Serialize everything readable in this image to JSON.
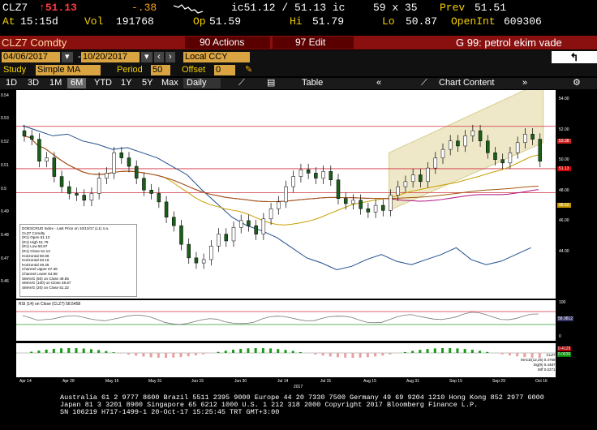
{
  "quote": {
    "ticker": "CLZ7",
    "last": "51.13",
    "chg": "-.38",
    "vol_label": "Vol",
    "volume": "191768",
    "ic": "ic51.12 / 51.13 ic",
    "size": "59 x 35",
    "prev_label": "Prev",
    "prev": "51.51",
    "at_label": "At",
    "time": "15:15d",
    "op_label": "Op",
    "open": "51.59",
    "hi_label": "Hi",
    "high": "51.79",
    "lo_label": "Lo",
    "low": "50.87",
    "oi_label": "OpenInt",
    "open_interest": "609306"
  },
  "toolbar": {
    "security": "CLZ7 Comdty",
    "actions_label": "90 Actions",
    "edit_label": "97 Edit",
    "title": "G 99: petrol ekim vade"
  },
  "dates": {
    "start": "04/06/2017",
    "end": "10/20/2017",
    "ccy": "Local CCY"
  },
  "study": {
    "label": "Study",
    "type": "Simple MA",
    "period_label": "Period",
    "period": "50",
    "offset_label": "Offset",
    "offset": "0"
  },
  "ranges": {
    "items": [
      "1D",
      "3D",
      "1M",
      "6M",
      "YTD",
      "1Y",
      "5Y",
      "Max"
    ],
    "active": "6M",
    "freq": "Daily",
    "table": "Table",
    "chart_content": "Chart Content"
  },
  "yaxis": [
    "54.00",
    "52.00",
    "50.00",
    "48.00",
    "46.00",
    "44.00"
  ],
  "left_axis": [
    "0.54",
    "0.53",
    "0.52",
    "0.51",
    "0.5",
    "0.49",
    "0.48",
    "0.47",
    "0.46",
    "0.45"
  ],
  "right_tags": [
    "51.13",
    "48.62",
    "53.38"
  ],
  "xaxis": [
    "Apr 14",
    "Apr 28",
    "May 15",
    "May 31",
    "Jun 15",
    "Jun 30",
    "Jul 14",
    "Jul 31",
    "Aug 15",
    "Aug 31",
    "Sep 15",
    "Sep 29",
    "Oct 16"
  ],
  "xyear": "2017",
  "legend": [
    "DOESCRUD Index - Last Price on 10/13/17 (L1) n.a.",
    "CLZ7 Comdty",
    "(R1) Open 51.13",
    "(R1) High 51.79",
    "(R1) Low 50.87",
    "(R1) Close 51.13",
    "Horizontal 50.66",
    "Horizontal 53.16",
    "Horizontal 49.25",
    "Channel Upper 57.38",
    "Channel Lower 54.88",
    "SMAVG (50) on Close 49.85",
    "SMAVG (100) on Close 48.57",
    "SMAVG (20) on Close 51.32"
  ],
  "rsi": {
    "label": "RSI (14) on Close (CLZ7) 58.5458",
    "value": "58.9812",
    "ticks": [
      "100",
      "50",
      "0"
    ]
  },
  "macd": {
    "title": "CLZ7",
    "lines": [
      "MACD(12,26) 0.4758",
      "Sig(9) 0.4487",
      "Diff 0.0271"
    ],
    "values": [
      "0.4129",
      "0.0635"
    ]
  },
  "footer": [
    "Australia 61 2 9777 8600 Brazil 5511 2395 9000 Europe 44 20 7330 7500 Germany 49 69 9204 1210 Hong Kong 852 2977 6000",
    "Japan 81 3 3201 8900     Singapore 65 6212 1000     U.S. 1 212 318 2000         Copyright 2017 Bloomberg Finance L.P.",
    "                                                          SN 106219 H717-1499-1 20-Oct-17 15:25:45 TRT  GMT+3:00"
  ],
  "chart_data": {
    "type": "candlestick",
    "series": [
      {
        "name": "CLZ7 Comdty",
        "close": [
          52.6,
          52.4,
          51.1,
          51.3,
          50.2,
          49.6,
          49.2,
          49.1,
          48.8,
          49.2,
          50.1,
          50.4,
          51.6,
          51.3,
          50.8,
          50.1,
          49.4,
          49.2,
          48.7,
          47.8,
          47.3,
          46.2,
          45.4,
          45.1,
          45.3,
          46.1,
          46.8,
          46.4,
          47.2,
          47.6,
          47.3,
          46.8,
          47.7,
          48.3,
          48.7,
          49.6,
          50.2,
          50.6,
          50.4,
          50.1,
          50.5,
          50.0,
          48.9,
          48.6,
          48.8,
          48.3,
          48.1,
          48.5,
          48.2,
          49.1,
          49.6,
          49.9,
          50.3,
          49.9,
          50.7,
          51.3,
          51.8,
          52.3,
          52.0,
          52.6,
          52.9,
          52.3,
          51.6,
          51.2,
          51.0,
          51.6,
          52.2,
          52.7,
          52.4,
          51.1
        ]
      }
    ]
  }
}
